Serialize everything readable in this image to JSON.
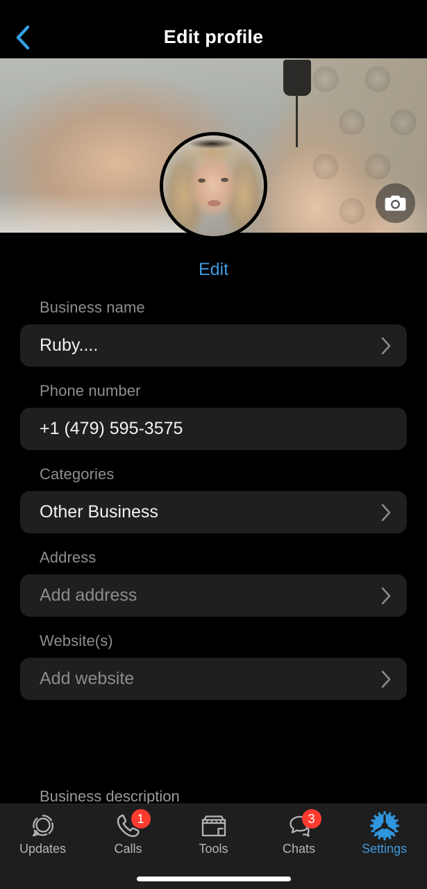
{
  "header": {
    "title": "Edit profile",
    "back_icon": "chevron-left-icon",
    "back_color": "#34a2e8"
  },
  "cover": {
    "camera_icon": "camera-icon"
  },
  "avatar": {
    "edit_label": "Edit",
    "edit_color": "#3f9ae0"
  },
  "form": {
    "fields": [
      {
        "label": "Business name",
        "value": "Ruby....",
        "is_placeholder": false,
        "has_chevron": true,
        "name": "business-name"
      },
      {
        "label": "Phone number",
        "value": "+1 (479) 595-3575",
        "is_placeholder": false,
        "has_chevron": false,
        "name": "phone-number"
      },
      {
        "label": "Categories",
        "value": "Other Business",
        "is_placeholder": false,
        "has_chevron": true,
        "name": "categories"
      },
      {
        "label": "Address",
        "value": "Add address",
        "is_placeholder": true,
        "has_chevron": true,
        "name": "address"
      },
      {
        "label": "Website(s)",
        "value": "Add website",
        "is_placeholder": true,
        "has_chevron": true,
        "name": "websites"
      }
    ],
    "description_label": "Business description"
  },
  "tab_bar": {
    "active": "Settings",
    "accent_color": "#3f9ae0",
    "badge_color": "#ff3b30",
    "items": [
      {
        "label": "Updates",
        "icon": "status-updates-icon",
        "badge": null
      },
      {
        "label": "Calls",
        "icon": "phone-icon",
        "badge": "1"
      },
      {
        "label": "Tools",
        "icon": "storefront-icon",
        "badge": null
      },
      {
        "label": "Chats",
        "icon": "chat-bubbles-icon",
        "badge": "3"
      },
      {
        "label": "Settings",
        "icon": "gear-icon",
        "badge": null
      }
    ]
  }
}
